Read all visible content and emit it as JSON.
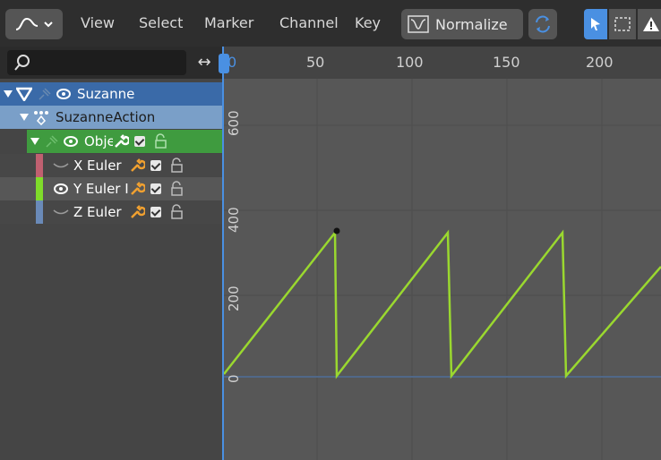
{
  "header": {
    "menus": [
      "View",
      "Select",
      "Marker",
      "Channel",
      "Key"
    ],
    "normalize_label": "Normalize"
  },
  "search": {
    "placeholder": "",
    "value": ""
  },
  "timeline": {
    "ticks": [
      "0",
      "50",
      "100",
      "150",
      "200"
    ]
  },
  "y_ticks": [
    "600",
    "400",
    "200",
    "0"
  ],
  "channels": [
    {
      "label": "Suzanne",
      "color": "#3a6aa8"
    },
    {
      "label": "SuzanneAction",
      "color": "#7a9fc8"
    },
    {
      "label": "Obje",
      "color": "#3f9b3f"
    },
    {
      "label": "X Euler",
      "color": "#c06070"
    },
    {
      "label": "Y Euler I",
      "color": "#7fdc2a"
    },
    {
      "label": "Z Euler",
      "color": "#6a8ab8"
    }
  ],
  "colors": {
    "curve": "#9ad82f",
    "accent": "#4a90e2"
  }
}
